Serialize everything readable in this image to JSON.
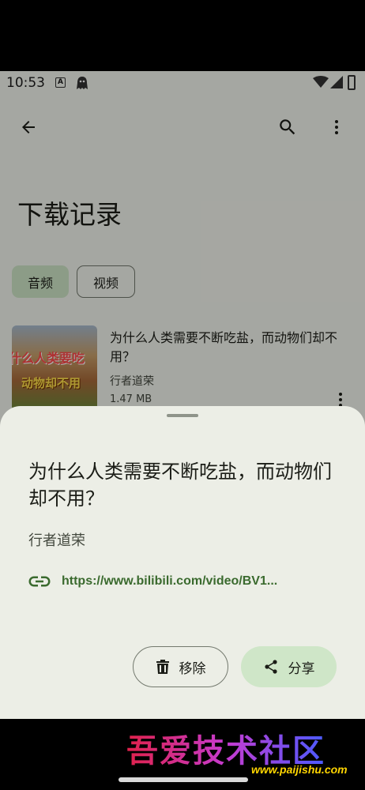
{
  "status_bar": {
    "time": "10:53",
    "a_badge": "A",
    "icons": [
      "a-notification-icon",
      "ghost-notification-icon",
      "wifi-icon",
      "signal-icon",
      "battery-icon"
    ]
  },
  "app_bar": {
    "icons": [
      "back-arrow-icon",
      "search-icon",
      "more-vert-icon"
    ]
  },
  "page": {
    "title": "下载记录"
  },
  "tabs": [
    {
      "label": "音频",
      "selected": true
    },
    {
      "label": "视频",
      "selected": false
    }
  ],
  "download_item": {
    "title": "为什么人类需要不断吃盐，而动物们却不用？",
    "author": "行者道荣",
    "size": "1.47 MB",
    "thumbnail_text_1": "什么人类要吃",
    "thumbnail_text_2": "动物却不用"
  },
  "sheet": {
    "title": "为什么人类需要不断吃盐，而动物们却不用？",
    "author": "行者道荣",
    "link": "https://www.bilibili.com/video/BV1...",
    "remove_label": "移除",
    "share_label": "分享"
  },
  "watermark": {
    "text": "吾爱技术社区",
    "url": "www.paijishu.com"
  },
  "colors": {
    "accent_container": "#cfe6c8",
    "link": "#3a6a2e",
    "sheet_bg": "#eceee6",
    "screen_bg": "#f4f6ef"
  }
}
